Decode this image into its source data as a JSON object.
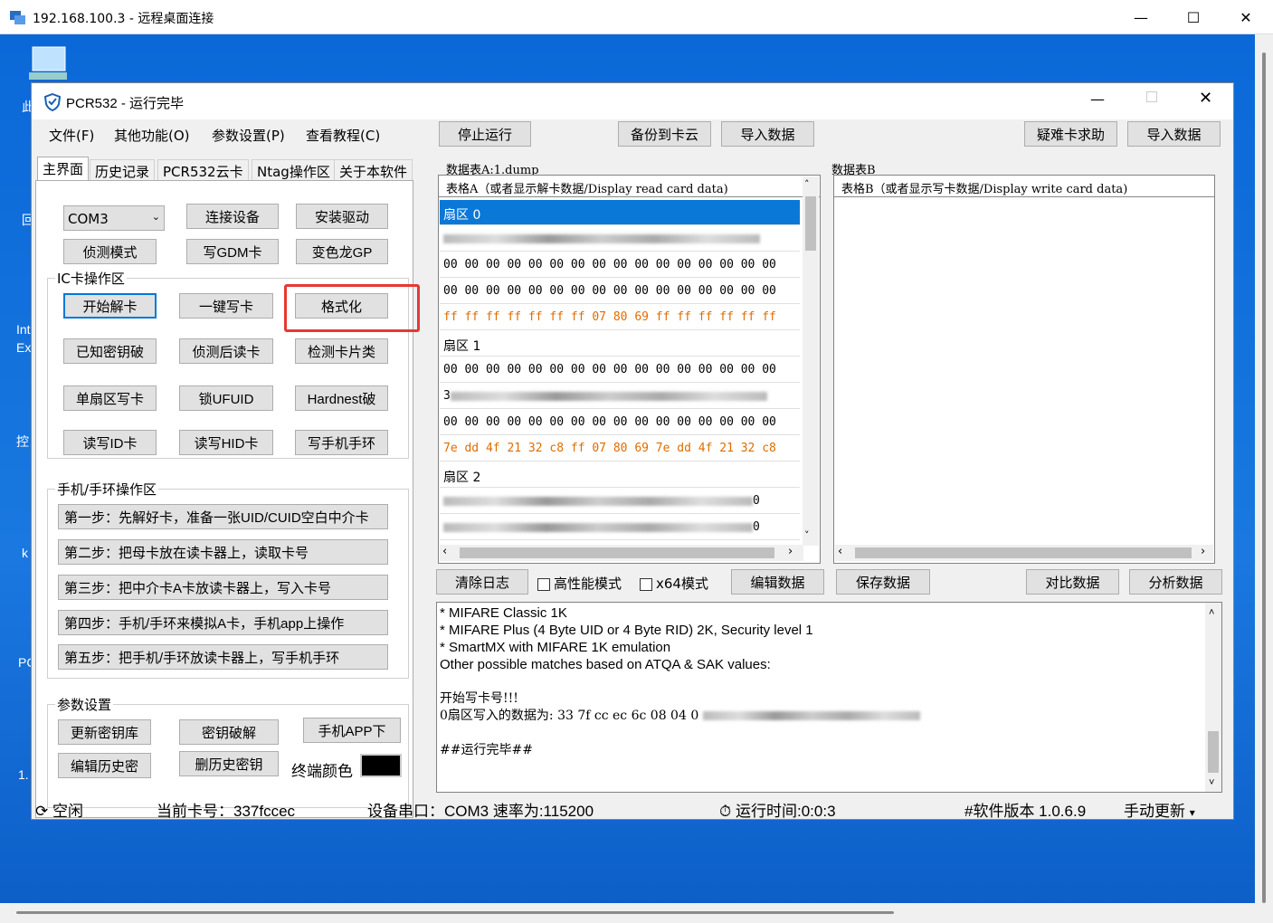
{
  "rdp": {
    "title": "192.168.100.3 - 远程桌面连接",
    "min": "—",
    "max": "☐",
    "close": "✕"
  },
  "desktop": {
    "icons": [
      "此",
      "回",
      "Int",
      "Ex",
      "控",
      "k",
      "PC",
      "1."
    ]
  },
  "app": {
    "title": "PCR532 - 运行完毕",
    "menu": [
      "文件(F)",
      "其他功能(O)",
      "参数设置(P)",
      "查看教程(C)"
    ],
    "top_buttons": {
      "stop": "停止运行",
      "backup": "备份到卡云",
      "import1": "导入数据",
      "help": "疑难卡求助",
      "import2": "导入数据"
    },
    "tabs": [
      "主界面",
      "历史记录",
      "PCR532云卡",
      "Ntag操作区",
      "关于本软件"
    ],
    "com": "COM3",
    "row1": {
      "connect": "连接设备",
      "install": "安装驱动"
    },
    "row2": {
      "detect": "侦测模式",
      "gdm": "写GDM卡",
      "gp": "变色龙GP"
    },
    "ic_group": "IC卡操作区",
    "ic": [
      [
        "开始解卡",
        "一键写卡",
        "格式化"
      ],
      [
        "已知密钥破",
        "侦测后读卡",
        "检测卡片类"
      ],
      [
        "单扇区写卡",
        "锁UFUID",
        "Hardnest破"
      ],
      [
        "读写ID卡",
        "读写HID卡",
        "写手机手环"
      ]
    ],
    "phone_group": "手机/手环操作区",
    "steps": [
      "第一步：先解好卡，准备一张UID/CUID空白中介卡",
      "第二步：把母卡放在读卡器上，读取卡号",
      "第三步：把中介卡A卡放读卡器上，写入卡号",
      "第四步：手机/手环来模拟A卡，手机app上操作",
      "第五步：把手机/手环放读卡器上，写手机手环"
    ],
    "param_group": "参数设置",
    "params": {
      "update": "更新密钥库",
      "crack": "密钥破解",
      "app": "手机APP下",
      "edit": "编辑历史密",
      "delete": "删历史密钥",
      "term": "终端颜色"
    },
    "tableA": {
      "label": "数据表A:1.dump",
      "header": "表格A（或者显示解卡数据/Display read card data)"
    },
    "tableB": {
      "label": "数据表B",
      "header": "表格B（或者显示写卡数据/Display write card data)"
    },
    "rows": {
      "s0": "扇区 0",
      "z": "00 00 00 00 00 00 00 00 00 00 00 00 00 00 00 00",
      "t0": "ff ff ff ff ff ff ff 07 80 69 ff ff ff ff ff ff",
      "s1": "扇区 1",
      "r3": "3",
      "t1": "7e dd 4f 21 32 c8 ff 07 80 69 7e dd 4f 21 32 c8",
      "s2": "扇区 2",
      "r0": "0"
    },
    "mid_buttons": {
      "clear": "清除日志",
      "hp": "高性能模式",
      "x64": "x64模式",
      "edit": "编辑数据",
      "save": "保存数据",
      "compare": "对比数据",
      "analyze": "分析数据"
    },
    "log": [
      "* MIFARE Classic 1K",
      "* MIFARE Plus (4 Byte UID or 4 Byte RID) 2K, Security level 1",
      "* SmartMX with MIFARE 1K emulation",
      "Other possible matches based on ATQA & SAK values:",
      "",
      "开始写卡号!!!",
      "0扇区写入的数据为: 33  7f  cc  ec  6c  08  04  0",
      "",
      "##运行完毕##"
    ],
    "status": {
      "state": "空闲",
      "card": "当前卡号：337fccec",
      "port": "设备串口：COM3 速率为:115200",
      "time": "运行时间:0:0:3",
      "ver": "#软件版本 1.0.6.9",
      "update": "手动更新"
    }
  },
  "colors": {
    "desktop": "#1a78e0",
    "selection": "#0a78d7",
    "hex_orange": "#e06c00",
    "highlight": "#e53935"
  }
}
